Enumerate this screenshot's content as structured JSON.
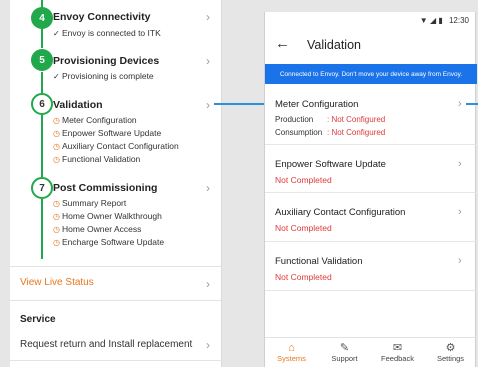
{
  "steps": [
    {
      "number": "4",
      "title": "Envoy Connectivity",
      "items": [
        "Envoy is connected to ITK"
      ]
    },
    {
      "number": "5",
      "title": "Provisioning Devices",
      "items": [
        "Provisioning is complete"
      ]
    },
    {
      "number": "6",
      "title": "Validation",
      "items": [
        "Meter Configuration",
        "Enpower Software Update",
        "Auxiliary Contact Configuration",
        "Functional Validation"
      ]
    },
    {
      "number": "7",
      "title": "Post Commissioning",
      "items": [
        "Summary Report",
        "Home Owner Walkthrough",
        "Home Owner Access",
        "Encharge Software Update"
      ]
    }
  ],
  "left": {
    "view_live_status": "View Live Status",
    "service_heading": "Service",
    "request_return": "Request return and Install replacement"
  },
  "phone": {
    "time": "12:30",
    "title": "Validation",
    "banner": "Connected to Envoy. Don't move your device away from Envoy.",
    "items": [
      {
        "title": "Meter Configuration",
        "production_label": "Production",
        "production_value": ": Not Configured",
        "consumption_label": "Consumption",
        "consumption_value": ": Not Configured"
      },
      {
        "title": "Enpower Software Update",
        "status": "Not Completed"
      },
      {
        "title": "Auxiliary Contact Configuration",
        "status": "Not Completed"
      },
      {
        "title": "Functional Validation",
        "status": "Not Completed"
      }
    ],
    "tabs": [
      {
        "label": "Systems",
        "icon": "home-icon",
        "active": true
      },
      {
        "label": "Support",
        "icon": "wrench-icon",
        "active": false
      },
      {
        "label": "Feedback",
        "icon": "feedback-icon",
        "active": false
      },
      {
        "label": "Settings",
        "icon": "gear-icon",
        "active": false
      }
    ]
  },
  "colors": {
    "accent_orange": "#e87722",
    "success_green": "#21a84b",
    "banner_blue": "#1a73e8",
    "error_red": "#e03a3a",
    "arrow_blue": "#2f8fd8"
  }
}
